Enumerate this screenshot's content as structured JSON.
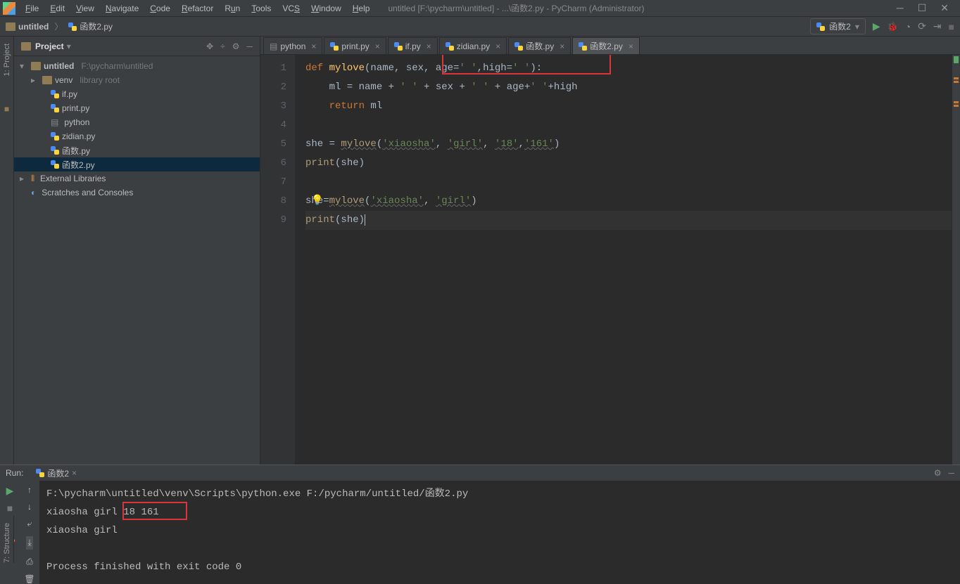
{
  "title": "untitled [F:\\pycharm\\untitled] - ...\\函数2.py - PyCharm (Administrator)",
  "menu": {
    "file": "File",
    "edit": "Edit",
    "view": "View",
    "navigate": "Navigate",
    "code": "Code",
    "refactor": "Refactor",
    "run": "Run",
    "tools": "Tools",
    "vcs": "VCS",
    "window": "Window",
    "help": "Help"
  },
  "breadcrumb": {
    "root": "untitled",
    "file": "函数2.py"
  },
  "run_config": "函数2",
  "project_panel": {
    "title": "Project",
    "root": "untitled",
    "root_path": "F:\\pycharm\\untitled",
    "venv": "venv",
    "venv_sub": "library root",
    "files": [
      "if.py",
      "print.py",
      "python",
      "zidian.py",
      "函数.py",
      "函数2.py"
    ],
    "ext_lib": "External Libraries",
    "scratches": "Scratches and Consoles"
  },
  "tabs": [
    {
      "name": "python",
      "active": false
    },
    {
      "name": "print.py",
      "active": false
    },
    {
      "name": "if.py",
      "active": false
    },
    {
      "name": "zidian.py",
      "active": false
    },
    {
      "name": "函数.py",
      "active": false
    },
    {
      "name": "函数2.py",
      "active": true
    }
  ],
  "code": {
    "l1": {
      "def": "def ",
      "fn": "mylove",
      "p": "(name, sex, age=",
      "s1": "' '",
      "c": ",high=",
      "s2": "' '",
      "end": "):"
    },
    "l2": {
      "pre": "    ml = name + ",
      "s1": "' '",
      "p2": " + sex + ",
      "s2": "' '",
      "p3": " + age+",
      "s3": "' '",
      "p4": "+high"
    },
    "l3": {
      "ret": "    return ",
      "v": "ml"
    },
    "l5": {
      "a": "she = ",
      "fn": "mylove",
      "p": "(",
      "s1": "'xiaosha'",
      "c1": ", ",
      "s2": "'girl'",
      "c2": ", ",
      "s3": "'18'",
      "c3": ",",
      "s4": "'161'",
      "e": ")"
    },
    "l6": {
      "fn": "print",
      "p": "(she)"
    },
    "l8": {
      "a": "she=",
      "fn": "mylove",
      "p": "(",
      "s1": "'xiaosha'",
      "c1": ", ",
      "s2": "'girl'",
      "e": ")"
    },
    "l9": {
      "fn": "print",
      "p": "(she)"
    }
  },
  "run_panel": {
    "title": "Run:",
    "tab": "函数2",
    "out1": "F:\\pycharm\\untitled\\venv\\Scripts\\python.exe F:/pycharm/untitled/函数2.py",
    "out2": "xiaosha girl 18 161",
    "out3": "xiaosha girl",
    "out4": "Process finished with exit code 0"
  },
  "vertical": {
    "project": "1: Project",
    "structure": "7: Structure"
  }
}
